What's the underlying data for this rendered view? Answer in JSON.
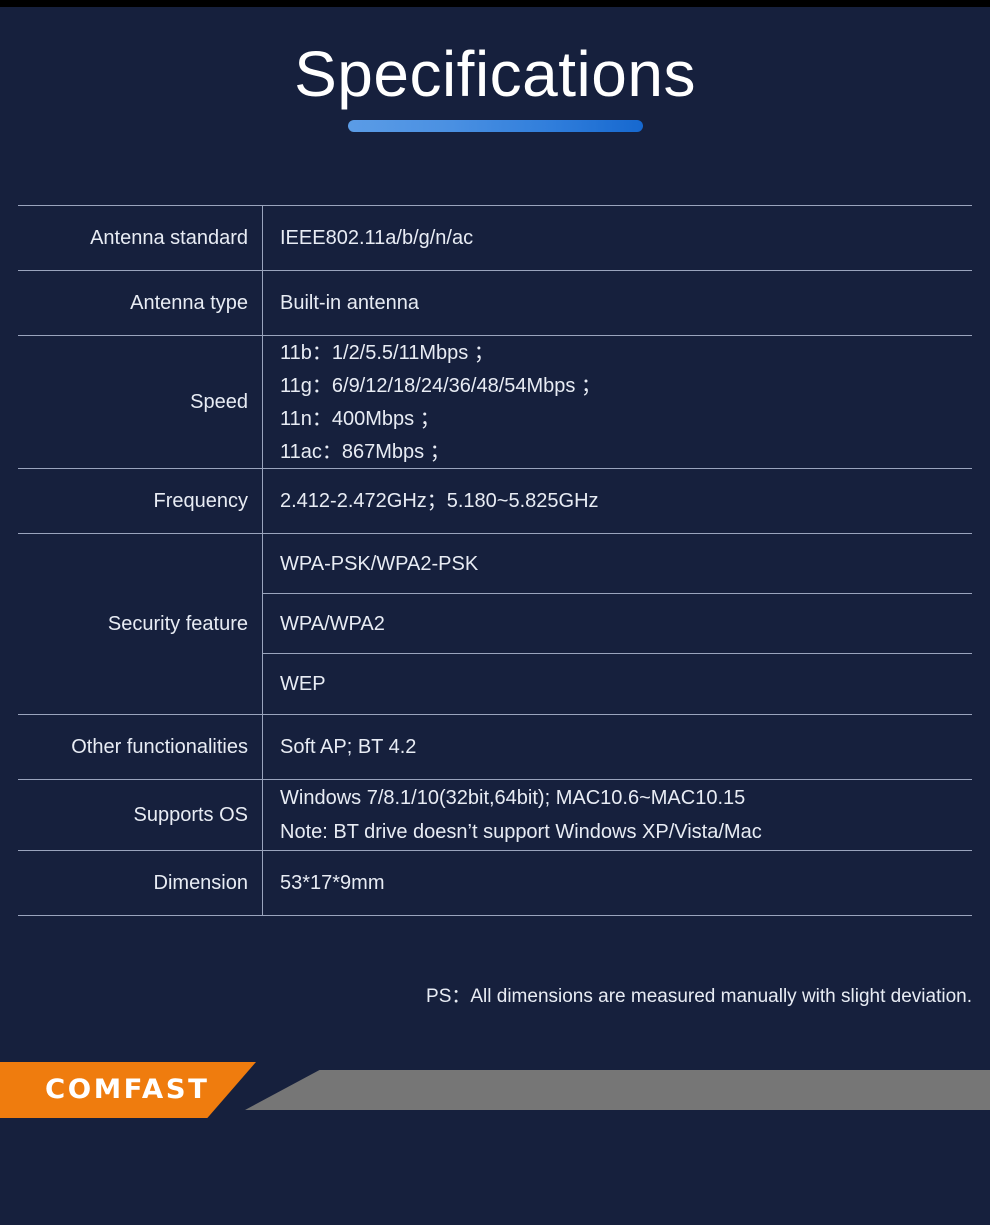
{
  "header": {
    "title": "Specifications",
    "accent_color": "#4a90e2"
  },
  "theme": {
    "background": "#16203d",
    "text_color": "#e8ecf4",
    "rule_color": "#9aa4bd",
    "brand_orange": "#ef7c0e",
    "brand_gray": "#767676"
  },
  "spec_table": {
    "rows": [
      {
        "label": "Antenna standard",
        "values": [
          "IEEE802.11a/b/g/n/ac"
        ]
      },
      {
        "label": "Antenna type",
        "values": [
          "Built-in antenna"
        ]
      },
      {
        "label": "Speed",
        "values": [
          "11b：1/2/5.5/11Mbps ；",
          "11g：6/9/12/18/24/36/48/54Mbps ；",
          "11n：400Mbps ；",
          "11ac：867Mbps ；"
        ]
      },
      {
        "label": "Frequency",
        "values": [
          "2.412-2.472GHz；5.180~5.825GHz"
        ]
      },
      {
        "label": "Security feature",
        "values": [
          "WPA-PSK/WPA2-PSK",
          "WPA/WPA2",
          "WEP"
        ]
      },
      {
        "label": "Other functionalities",
        "values": [
          "Soft AP; BT 4.2"
        ]
      },
      {
        "label": "Supports OS",
        "values": [
          "Windows 7/8.1/10(32bit,64bit); MAC10.6~MAC10.15",
          "Note: BT drive doesn’t support Windows XP/Vista/Mac"
        ]
      },
      {
        "label": "Dimension",
        "values": [
          "53*17*9mm"
        ]
      }
    ]
  },
  "footnote": "PS：All dimensions are measured manually with slight deviation.",
  "brand": {
    "wordmark": "COMFAST"
  }
}
